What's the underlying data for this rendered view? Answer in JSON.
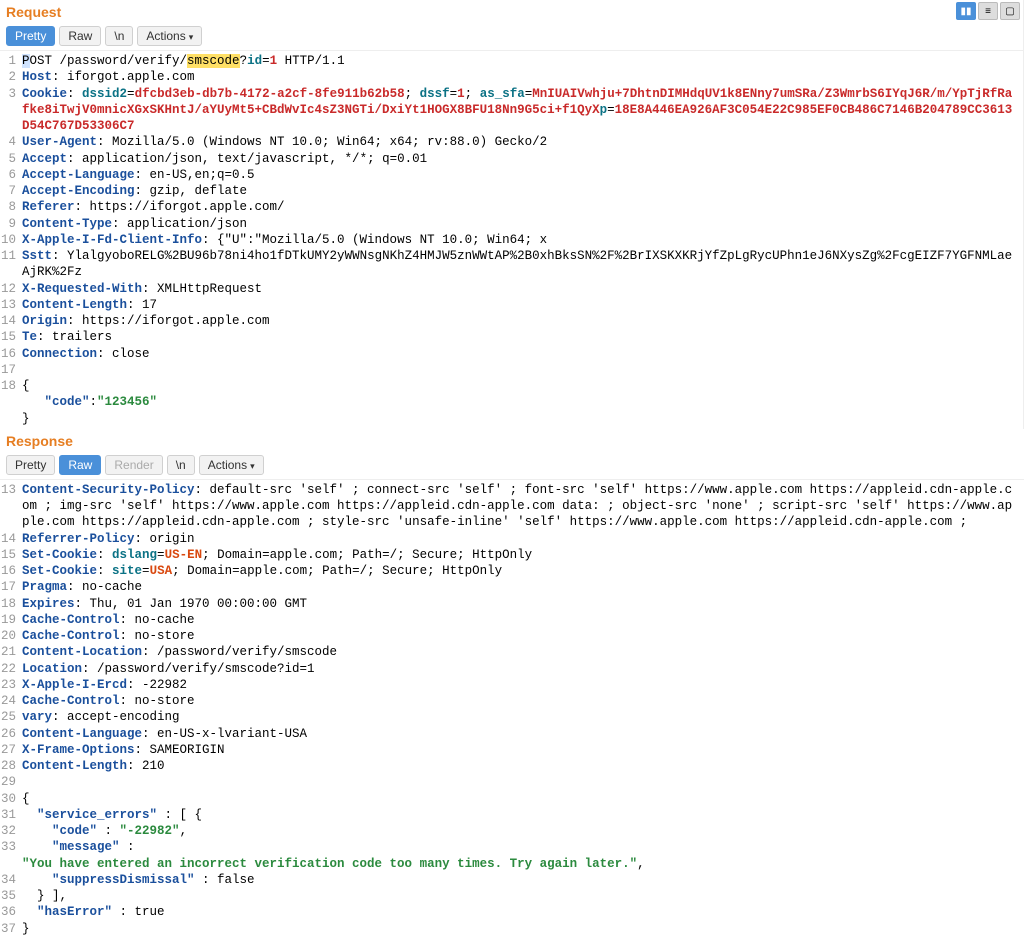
{
  "layout_buttons": {
    "side_by_side": "▮▮",
    "stacked": "≡",
    "single": "▢"
  },
  "request": {
    "title": "Request",
    "toolbar": {
      "pretty": "Pretty",
      "raw": "Raw",
      "newline": "\\n",
      "actions": "Actions"
    },
    "lines": [
      {
        "n": 1,
        "segs": [
          {
            "t": "P",
            "c": "t-black cursor-mark"
          },
          {
            "t": "OST /password/verify/",
            "c": "t-black"
          },
          {
            "t": "smscode",
            "c": "t-black hl"
          },
          {
            "t": "?",
            "c": "t-black"
          },
          {
            "t": "id",
            "c": "t-teal"
          },
          {
            "t": "=",
            "c": "t-black"
          },
          {
            "t": "1",
            "c": "t-red"
          },
          {
            "t": " HTTP/1.1",
            "c": "t-black"
          }
        ]
      },
      {
        "n": 2,
        "segs": [
          {
            "t": "Host",
            "c": "t-blue"
          },
          {
            "t": ": iforgot.apple.com",
            "c": "t-black"
          }
        ]
      },
      {
        "n": 3,
        "segs": [
          {
            "t": "Cookie",
            "c": "t-blue"
          },
          {
            "t": ": ",
            "c": "t-black"
          },
          {
            "t": "dssid2",
            "c": "t-teal"
          },
          {
            "t": "=",
            "c": "t-black"
          },
          {
            "t": "dfcbd3eb-db7b-4172-a2cf-8fe911b62b58",
            "c": "t-red"
          },
          {
            "t": "; ",
            "c": "t-black"
          },
          {
            "t": "dssf",
            "c": "t-teal"
          },
          {
            "t": "=",
            "c": "t-black"
          },
          {
            "t": "1",
            "c": "t-red"
          },
          {
            "t": "; ",
            "c": "t-black"
          },
          {
            "t": "as_sfa",
            "c": "t-teal"
          },
          {
            "t": "=",
            "c": "t-black"
          },
          {
            "t": "MnIUAIVwhju+7DhtnDIMHdqUV1k8ENny7umSRa/Z3WmrbS6IYqJ6R/m/YpTjRfRafke8iTwjV0mnicXGxSKHntJ/aYUyMt5+CBdWvIc4sZ3NGTi/DxiYt1HOGX8BFU18Nn9G5ci+f1QyX",
            "c": "t-red"
          },
          {
            "t": "p",
            "c": "t-teal"
          },
          {
            "t": "=",
            "c": "t-black"
          },
          {
            "t": "18E8A446EA926AF3C054E22C985EF0CB486C7146B204789CC3613D54C767D53306C7",
            "c": "t-red"
          }
        ]
      },
      {
        "n": 4,
        "segs": [
          {
            "t": "User-Agent",
            "c": "t-blue"
          },
          {
            "t": ": Mozilla/5.0 (Windows NT 10.0; Win64; x64; rv:88.0) Gecko/2",
            "c": "t-black"
          }
        ]
      },
      {
        "n": 5,
        "segs": [
          {
            "t": "Accept",
            "c": "t-blue"
          },
          {
            "t": ": application/json, text/javascript, */*; q=0.01",
            "c": "t-black"
          }
        ]
      },
      {
        "n": 6,
        "segs": [
          {
            "t": "Accept-Language",
            "c": "t-blue"
          },
          {
            "t": ": en-US,en;q=0.5",
            "c": "t-black"
          }
        ]
      },
      {
        "n": 7,
        "segs": [
          {
            "t": "Accept-Encoding",
            "c": "t-blue"
          },
          {
            "t": ": gzip, deflate",
            "c": "t-black"
          }
        ]
      },
      {
        "n": 8,
        "segs": [
          {
            "t": "Referer",
            "c": "t-blue"
          },
          {
            "t": ": https://iforgot.apple.com/",
            "c": "t-black"
          }
        ]
      },
      {
        "n": 9,
        "segs": [
          {
            "t": "Content-Type",
            "c": "t-blue"
          },
          {
            "t": ": application/json",
            "c": "t-black"
          }
        ]
      },
      {
        "n": 10,
        "segs": [
          {
            "t": "X-Apple-I-Fd-Client-Info",
            "c": "t-blue"
          },
          {
            "t": ": {\"U\":\"Mozilla/5.0 (Windows NT 10.0; Win64; x",
            "c": "t-black"
          }
        ]
      },
      {
        "n": 11,
        "segs": [
          {
            "t": "Sstt",
            "c": "t-blue"
          },
          {
            "t": ": YlalgyoboRELG%2BU96b78ni4ho1fDTkUMY2yWWNsgNKhZ4HMJW5znWWtAP%2B0xhBksSN%2F%2BrIXSKXKRjYfZpLgRycUPhn1eJ6NXysZg%2FcgEIZF7YGFNMLaeAjRK%2Fz",
            "c": "t-black"
          }
        ]
      },
      {
        "n": 12,
        "segs": [
          {
            "t": "X-Requested-With",
            "c": "t-blue"
          },
          {
            "t": ": XMLHttpRequest",
            "c": "t-black"
          }
        ]
      },
      {
        "n": 13,
        "segs": [
          {
            "t": "Content-Length",
            "c": "t-blue"
          },
          {
            "t": ": 17",
            "c": "t-black"
          }
        ]
      },
      {
        "n": 14,
        "segs": [
          {
            "t": "Origin",
            "c": "t-blue"
          },
          {
            "t": ": https://iforgot.apple.com",
            "c": "t-black"
          }
        ]
      },
      {
        "n": 15,
        "segs": [
          {
            "t": "Te",
            "c": "t-blue"
          },
          {
            "t": ": trailers",
            "c": "t-black"
          }
        ]
      },
      {
        "n": 16,
        "segs": [
          {
            "t": "Connection",
            "c": "t-blue"
          },
          {
            "t": ": close",
            "c": "t-black"
          }
        ]
      },
      {
        "n": 17,
        "segs": [
          {
            "t": "",
            "c": "t-black"
          }
        ]
      },
      {
        "n": 18,
        "segs": [
          {
            "t": "{",
            "c": "t-black"
          }
        ]
      },
      {
        "n": "",
        "segs": [
          {
            "t": "   \"code\"",
            "c": "t-blue"
          },
          {
            "t": ":",
            "c": "t-black"
          },
          {
            "t": "\"123456\"",
            "c": "t-green"
          }
        ]
      },
      {
        "n": "",
        "segs": [
          {
            "t": "}",
            "c": "t-black"
          }
        ]
      }
    ]
  },
  "response": {
    "title": "Response",
    "toolbar": {
      "pretty": "Pretty",
      "raw": "Raw",
      "render": "Render",
      "newline": "\\n",
      "actions": "Actions"
    },
    "lines": [
      {
        "n": 13,
        "segs": [
          {
            "t": "Content-Security-Policy",
            "c": "t-blue"
          },
          {
            "t": ": default-src 'self' ; connect-src 'self' ; font-src 'self' https://www.apple.com https://appleid.cdn-apple.com ; img-src 'self' https://www.apple.com https://appleid.cdn-apple.com data: ; object-src 'none' ; script-src 'self' https://www.apple.com https://appleid.cdn-apple.com ; style-src 'unsafe-inline' 'self' https://www.apple.com https://appleid.cdn-apple.com ;",
            "c": "t-black"
          }
        ]
      },
      {
        "n": 14,
        "segs": [
          {
            "t": "Referrer-Policy",
            "c": "t-blue"
          },
          {
            "t": ": origin",
            "c": "t-black"
          }
        ]
      },
      {
        "n": 15,
        "segs": [
          {
            "t": "Set-Cookie",
            "c": "t-blue"
          },
          {
            "t": ": ",
            "c": "t-black"
          },
          {
            "t": "dslang",
            "c": "t-teal"
          },
          {
            "t": "=",
            "c": "t-black"
          },
          {
            "t": "US-EN",
            "c": "t-orange"
          },
          {
            "t": "; Domain=apple.com; Path=/; Secure; HttpOnly",
            "c": "t-black"
          }
        ]
      },
      {
        "n": 16,
        "segs": [
          {
            "t": "Set-Cookie",
            "c": "t-blue"
          },
          {
            "t": ": ",
            "c": "t-black"
          },
          {
            "t": "site",
            "c": "t-teal"
          },
          {
            "t": "=",
            "c": "t-black"
          },
          {
            "t": "USA",
            "c": "t-orange"
          },
          {
            "t": "; Domain=apple.com; Path=/; Secure; HttpOnly",
            "c": "t-black"
          }
        ]
      },
      {
        "n": 17,
        "segs": [
          {
            "t": "Pragma",
            "c": "t-blue"
          },
          {
            "t": ": no-cache",
            "c": "t-black"
          }
        ]
      },
      {
        "n": 18,
        "segs": [
          {
            "t": "Expires",
            "c": "t-blue"
          },
          {
            "t": ": Thu, 01 Jan 1970 00:00:00 GMT",
            "c": "t-black"
          }
        ]
      },
      {
        "n": 19,
        "segs": [
          {
            "t": "Cache-Control",
            "c": "t-blue"
          },
          {
            "t": ": no-cache",
            "c": "t-black"
          }
        ]
      },
      {
        "n": 20,
        "segs": [
          {
            "t": "Cache-Control",
            "c": "t-blue"
          },
          {
            "t": ": no-store",
            "c": "t-black"
          }
        ]
      },
      {
        "n": 21,
        "segs": [
          {
            "t": "Content-Location",
            "c": "t-blue"
          },
          {
            "t": ": /password/verify/smscode",
            "c": "t-black"
          }
        ]
      },
      {
        "n": 22,
        "segs": [
          {
            "t": "Location",
            "c": "t-blue"
          },
          {
            "t": ": /password/verify/smscode?id=1",
            "c": "t-black"
          }
        ]
      },
      {
        "n": 23,
        "segs": [
          {
            "t": "X-Apple-I-Ercd",
            "c": "t-blue"
          },
          {
            "t": ": -22982",
            "c": "t-black"
          }
        ]
      },
      {
        "n": 24,
        "segs": [
          {
            "t": "Cache-Control",
            "c": "t-blue"
          },
          {
            "t": ": no-store",
            "c": "t-black"
          }
        ]
      },
      {
        "n": 25,
        "segs": [
          {
            "t": "vary",
            "c": "t-blue"
          },
          {
            "t": ": accept-encoding",
            "c": "t-black"
          }
        ]
      },
      {
        "n": 26,
        "segs": [
          {
            "t": "Content-Language",
            "c": "t-blue"
          },
          {
            "t": ": en-US-x-lvariant-USA",
            "c": "t-black"
          }
        ]
      },
      {
        "n": 27,
        "segs": [
          {
            "t": "X-Frame-Options",
            "c": "t-blue"
          },
          {
            "t": ": SAMEORIGIN",
            "c": "t-black"
          }
        ]
      },
      {
        "n": 28,
        "segs": [
          {
            "t": "Content-Length",
            "c": "t-blue"
          },
          {
            "t": ": 210",
            "c": "t-black"
          }
        ]
      },
      {
        "n": 29,
        "segs": [
          {
            "t": "",
            "c": "t-black"
          }
        ]
      },
      {
        "n": 30,
        "segs": [
          {
            "t": "{",
            "c": "t-black"
          }
        ]
      },
      {
        "n": 31,
        "segs": [
          {
            "t": "  \"service_errors\"",
            "c": "t-blue"
          },
          {
            "t": " : [ {",
            "c": "t-black"
          }
        ]
      },
      {
        "n": 32,
        "segs": [
          {
            "t": "    \"code\"",
            "c": "t-blue"
          },
          {
            "t": " : ",
            "c": "t-black"
          },
          {
            "t": "\"-22982\"",
            "c": "t-green"
          },
          {
            "t": ",",
            "c": "t-black"
          }
        ]
      },
      {
        "n": 33,
        "segs": [
          {
            "t": "    \"message\"",
            "c": "t-blue"
          },
          {
            "t": " : ",
            "c": "t-black"
          }
        ]
      },
      {
        "n": "",
        "segs": [
          {
            "t": "\"You have entered an incorrect verification code too many times. Try again later.\"",
            "c": "t-green"
          },
          {
            "t": ",",
            "c": "t-black"
          }
        ]
      },
      {
        "n": 34,
        "segs": [
          {
            "t": "    \"suppressDismissal\"",
            "c": "t-blue"
          },
          {
            "t": " : false",
            "c": "t-black"
          }
        ]
      },
      {
        "n": 35,
        "segs": [
          {
            "t": "  } ],",
            "c": "t-black"
          }
        ]
      },
      {
        "n": 36,
        "segs": [
          {
            "t": "  \"hasError\"",
            "c": "t-blue"
          },
          {
            "t": " : true",
            "c": "t-black"
          }
        ]
      },
      {
        "n": 37,
        "segs": [
          {
            "t": "}",
            "c": "t-black"
          }
        ]
      }
    ]
  }
}
